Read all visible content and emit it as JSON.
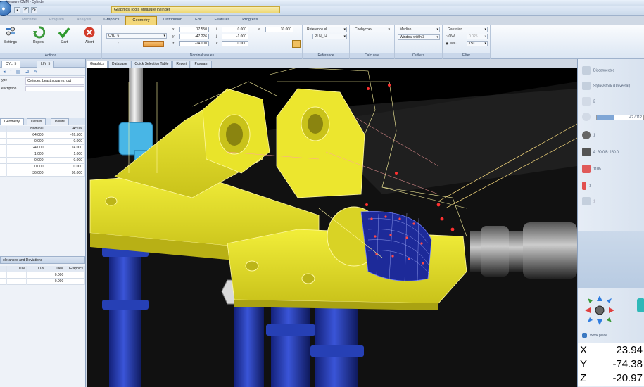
{
  "window": {
    "title": "Measure CMM - Cylinder"
  },
  "app_button": "●",
  "context_title": "Graphics Tools   Measure cylinder",
  "tabs": [
    {
      "label": "Machine",
      "state": "faded"
    },
    {
      "label": "Program",
      "state": "faded"
    },
    {
      "label": "Analysis",
      "state": "faded"
    },
    {
      "label": "Graphics",
      "state": "normal"
    },
    {
      "label": "Geometry",
      "state": "active"
    },
    {
      "label": "Distribution",
      "state": "normal"
    },
    {
      "label": "Edit",
      "state": "normal"
    },
    {
      "label": "Features",
      "state": "normal"
    },
    {
      "label": "Progress",
      "state": "normal"
    }
  ],
  "actions": {
    "group_label": "Actions",
    "settings": "Settings",
    "repeat": "Repeat",
    "start": "Start",
    "abort": "Abort"
  },
  "nominal": {
    "group_label": "Nominal values",
    "feature_select": "CYL_6",
    "x_label": "x",
    "x": "17.550",
    "y_label": "y",
    "y": "-47.226",
    "z_label": "z",
    "z": "-24.000",
    "i_label": "i",
    "i": "0.000",
    "j_label": "j",
    "j": "-1.000",
    "k_label": "k",
    "k": "0.000",
    "d_label": "ø",
    "d": "30.000"
  },
  "reference": {
    "group_label": "Reference",
    "select1": "Reference el...",
    "select2": "PLN_14"
  },
  "calculate": {
    "group_label": "Calculate",
    "method": "Chebychev"
  },
  "outliers": {
    "group_label": "Outliers",
    "filter": "Median",
    "window": "Window width 3"
  },
  "filter": {
    "group_label": "Filter",
    "type": "Gaussian",
    "opt1": "OWL",
    "opt1_val": "0.025",
    "opt2": "W/C",
    "opt2_val": "150"
  },
  "left": {
    "tabs": [
      "CYL_5",
      "LIN_5"
    ],
    "type_label": "ype",
    "type_value": "Cylinder, Least squares, out",
    "desc_label": "escription",
    "subtabs": [
      "Geometry",
      "Details",
      "Points"
    ],
    "geo_headers": [
      "Nominal",
      "Actual"
    ],
    "geo_rows": [
      [
        "64.000",
        "-26.500"
      ],
      [
        "0.000",
        "0.000"
      ],
      [
        "24.000",
        "24.000"
      ],
      [
        "1.000",
        "1.000"
      ],
      [
        "0.000",
        "0.000"
      ],
      [
        "0.000",
        "0.000"
      ],
      [
        "36.000",
        "36.000"
      ]
    ],
    "tol_title": "olerances and Deviations",
    "tol_headers": [
      "UTol",
      "LTol",
      "Dev.",
      "Graphics"
    ],
    "tol_rows": [
      [
        "",
        "",
        "0.000",
        ""
      ],
      [
        "",
        "",
        "0.000",
        ""
      ]
    ]
  },
  "view_tabs": [
    "Graphics",
    "Database",
    "Quick Selection Table",
    "Report",
    "Program"
  ],
  "right": {
    "disconnected": "Disconnected",
    "probe_info": "Stylus/stock (Universal)",
    "count": "2",
    "progress": "42 / 112",
    "progress_fraction": 0.375,
    "probe_num": "1",
    "angles": "A: 90.0  B: 180.0",
    "speed": "1105",
    "temp": "1",
    "item7": "1",
    "workpiece": "Work piece"
  },
  "dro": [
    {
      "axis": "X",
      "value": "23.94"
    },
    {
      "axis": "Y",
      "value": "-74.38"
    },
    {
      "axis": "Z",
      "value": "-20.97"
    }
  ]
}
